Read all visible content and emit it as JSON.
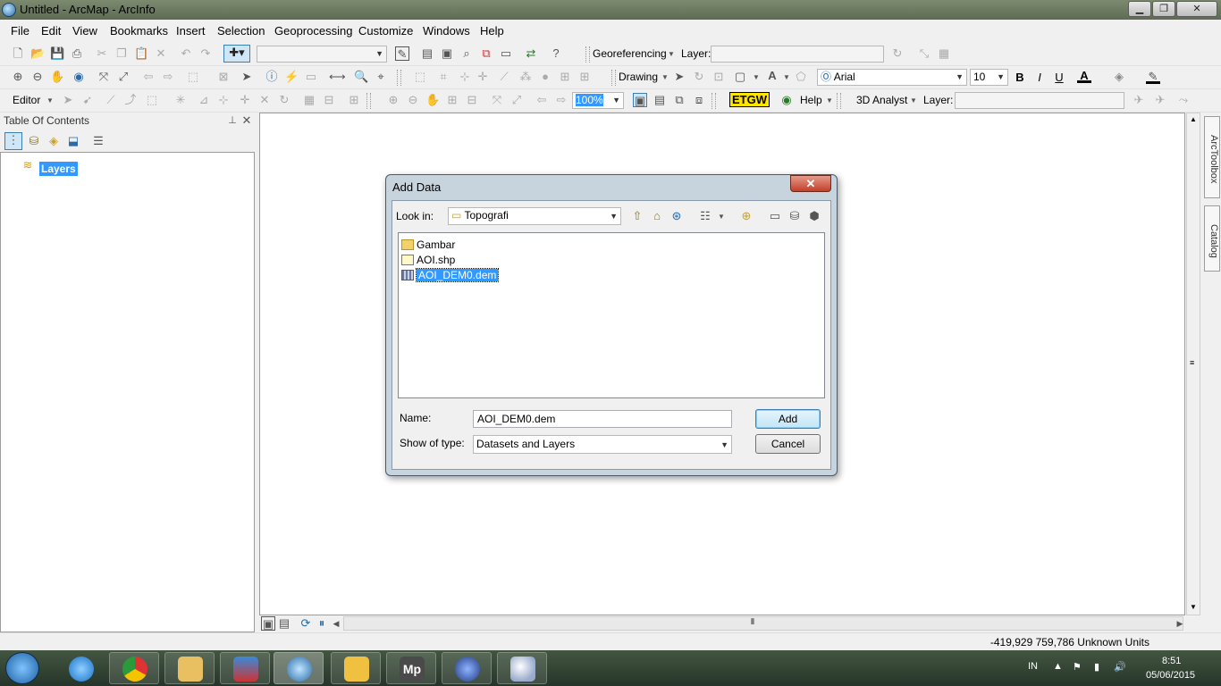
{
  "window": {
    "title": "Untitled - ArcMap - ArcInfo"
  },
  "menu": [
    "File",
    "Edit",
    "View",
    "Bookmarks",
    "Insert",
    "Selection",
    "Geoprocessing",
    "Customize",
    "Windows",
    "Help"
  ],
  "toolbar1": {
    "georef_label": "Georeferencing",
    "layer_label": "Layer:",
    "layer_value": ""
  },
  "toolbar2": {
    "drawing_label": "Drawing",
    "font_value": "Arial",
    "size_value": "10",
    "bold": "B",
    "italic": "I",
    "underline": "U"
  },
  "toolbar3": {
    "editor_label": "Editor",
    "zoom_value": "100%",
    "etgw_label": "ETGW",
    "help_label": "Help",
    "analyst_label": "3D Analyst",
    "layer_label": "Layer:",
    "layer_value": ""
  },
  "toc": {
    "title": "Table Of Contents",
    "pin": "⊕",
    "close": "✕",
    "root_layer": "Layers"
  },
  "dock": {
    "arctoolbox": "ArcToolbox",
    "catalog": "Catalog"
  },
  "status": {
    "coords": "-419,929  759,786 Unknown Units"
  },
  "dialog": {
    "title": "Add Data",
    "close": "✕",
    "lookin_label": "Look in:",
    "lookin_value": "Topografi",
    "files": [
      {
        "name": "Gambar",
        "type": "folder"
      },
      {
        "name": "AOI.shp",
        "type": "shapefile"
      },
      {
        "name": "AOI_DEM0.dem",
        "type": "raster",
        "selected": true
      }
    ],
    "name_label": "Name:",
    "name_value": "AOI_DEM0.dem",
    "type_label": "Show of type:",
    "type_value": "Datasets and Layers",
    "add_button": "Add",
    "cancel_button": "Cancel"
  },
  "taskbar": {
    "lang": "IN",
    "time": "8:51",
    "date": "05/06/2015"
  },
  "colors": {
    "selection": "#3399ff",
    "dialog_frame": "#c7d3dd",
    "close_red": "#c2402a"
  }
}
